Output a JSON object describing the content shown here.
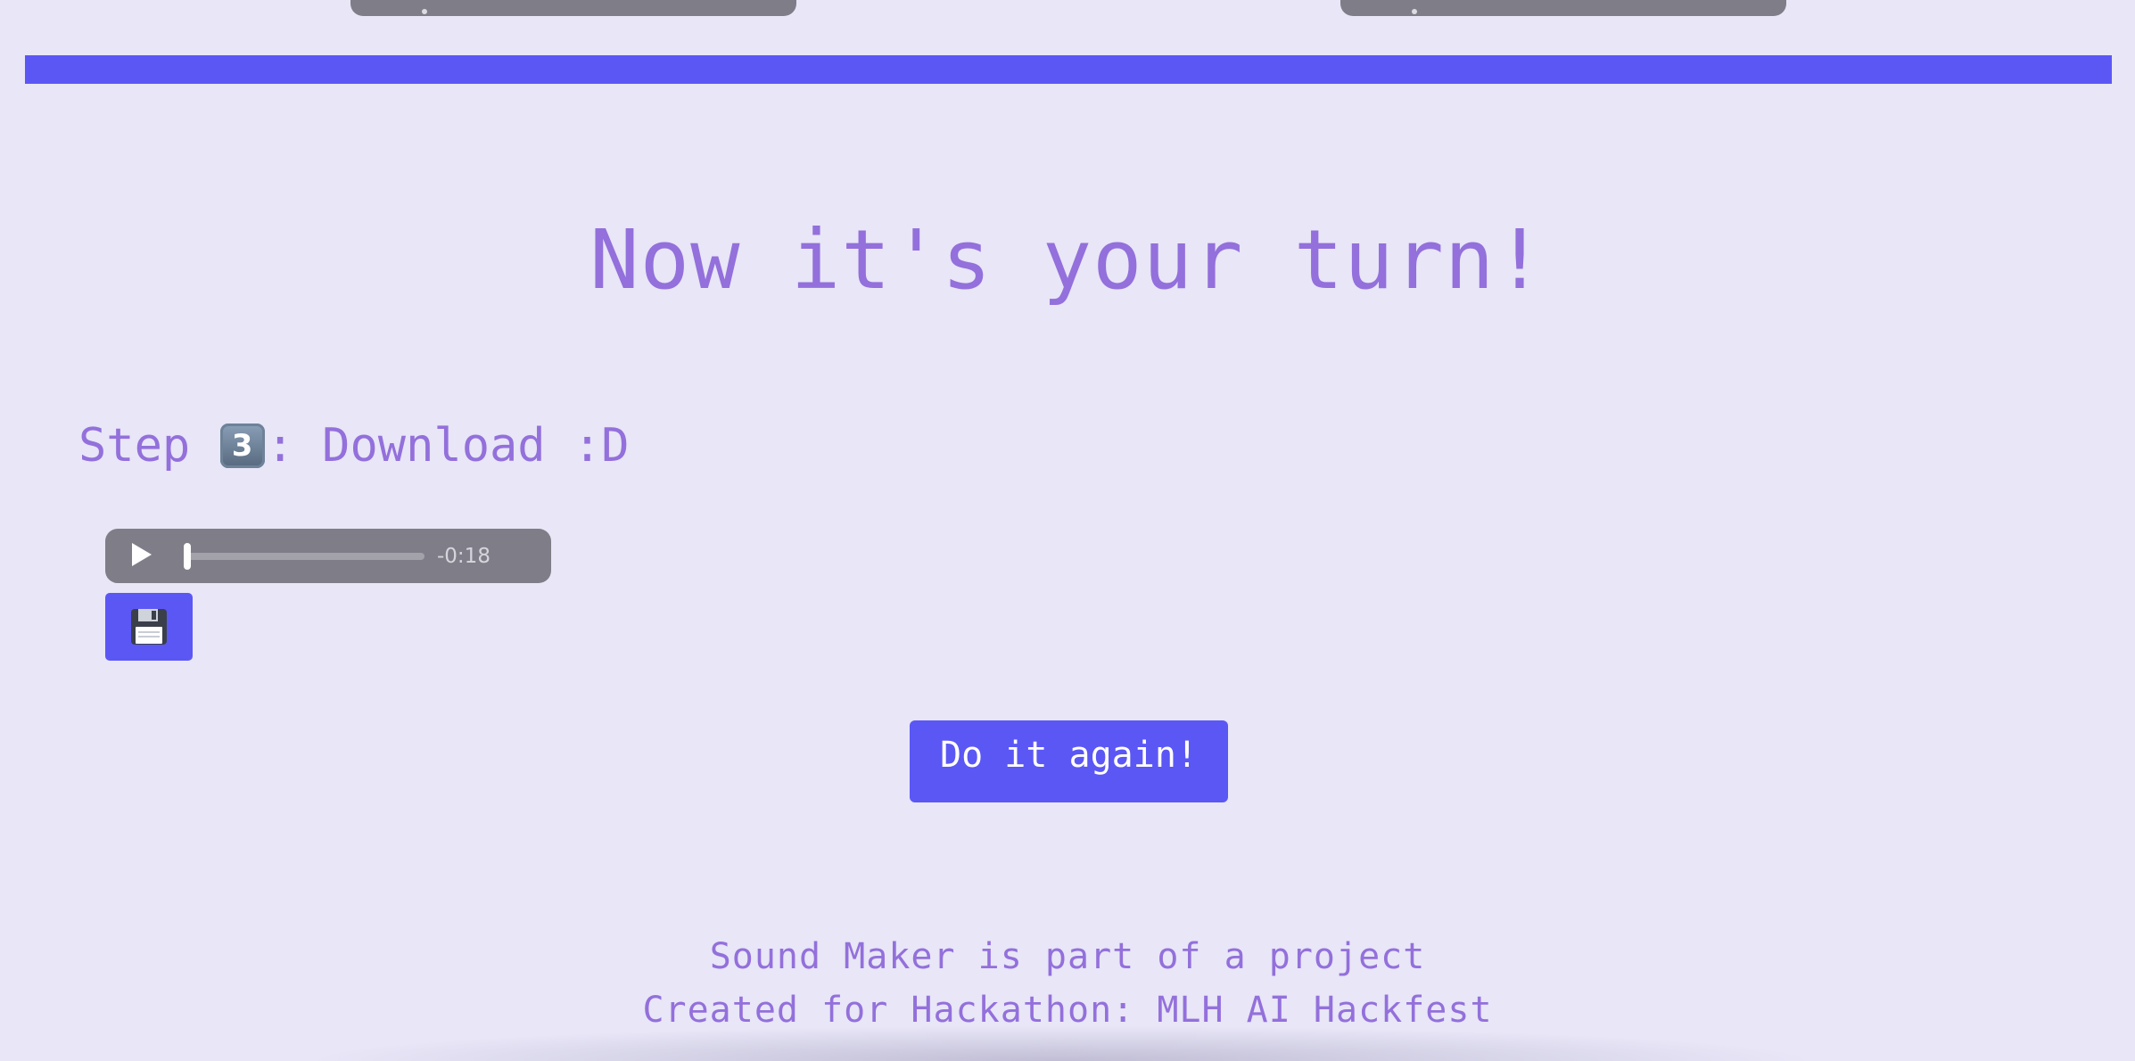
{
  "top_players": [
    {
      "label": "audio player"
    },
    {
      "label": "audio player"
    }
  ],
  "hero": {
    "title": "Now it's your turn!"
  },
  "step": {
    "prefix": "Step ",
    "number": "3",
    "suffix": ": Download :D"
  },
  "audio": {
    "time_remaining": "-0:18",
    "progress_fraction": 0
  },
  "save_button": {
    "icon": "floppy-disk-icon"
  },
  "again_button": {
    "label": "Do it again!"
  },
  "footer": {
    "line1": "Sound Maker is part of a project",
    "line2": "Created for Hackathon: MLH AI Hackfest"
  },
  "colors": {
    "background": "#e8e6f7",
    "accent": "#5b57f5",
    "text_purple": "#9370db",
    "player_gray": "#7f7e88"
  }
}
